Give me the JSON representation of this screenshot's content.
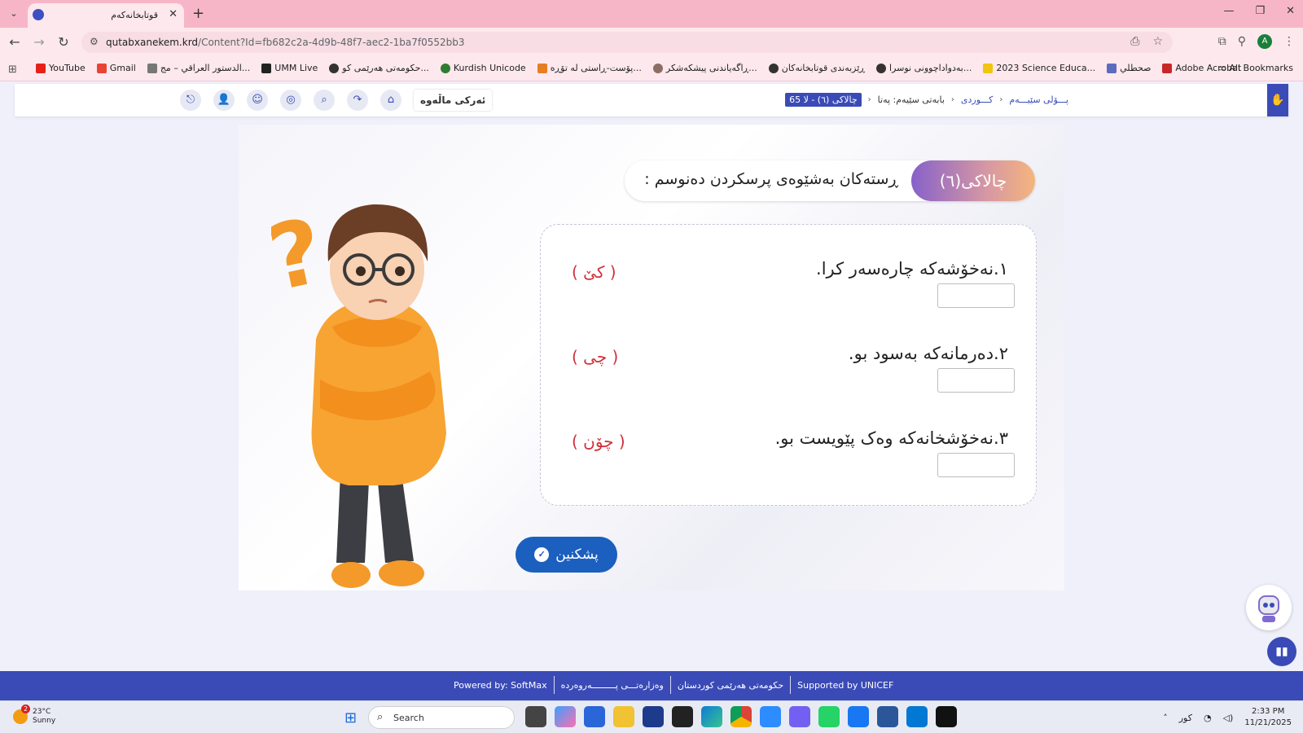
{
  "browser": {
    "tab_title": "قوتابخانەکەم",
    "url_host": "qutabxanekem.krd",
    "url_path": "/Content?Id=fb682c2a-4d9b-48f7-aec2-1ba7f0552bb3",
    "bookmarks": [
      "YouTube",
      "Gmail",
      "الدستور العراقي – مج...",
      "UMM Live",
      "حکومەتی هەرێمی کو...",
      "Kurdish Unicode",
      "پۆست-ڕاستی لە تۆڕە...",
      "ڕاگەیاندنی پیشکەشکر...",
      "ڕێزبەندی قوتابخانەکان",
      "بەدواداچوونی نوسرا...",
      "2023 Science Educa...",
      "صحطلي",
      "Adobe Acrobat"
    ],
    "all_bookmarks": "All Bookmarks",
    "profile_initial": "A"
  },
  "header": {
    "breadcrumb": [
      "پـــۆلی سێیـــەم",
      "کـــوردی",
      "بابەتی سێیەم: پەتا",
      "چالاکی (٦) - لا 65"
    ],
    "homework_label": "ئەرکی ماڵەوە"
  },
  "activity": {
    "badge": "چالاکی(٦)",
    "instruction": "ڕستەکان بەشێوەی پرسکردن دەنوسم :",
    "questions": [
      {
        "text": "١.نەخۆشەکە چارەسەر کرا.",
        "hint": "( کێ )"
      },
      {
        "text": "٢.دەرمانەکە بەسود بو.",
        "hint": "( چی )"
      },
      {
        "text": "٣.نەخۆشخانەکە وەک پێویست بو.",
        "hint": "( چۆن )"
      }
    ],
    "check_label": "پشکنین"
  },
  "footer": {
    "items": [
      "Powered by: SoftMax",
      "وەزارەتـــی پـــــــــەروەردە",
      "حکومەتی هەرێمی کوردستان",
      "Supported by UNICEF"
    ]
  },
  "taskbar": {
    "weather_temp": "23°C",
    "weather_desc": "Sunny",
    "weather_badge": "2",
    "search_placeholder": "Search",
    "language": "کور",
    "time": "2:33 PM",
    "date": "11/21/2025"
  },
  "colors": {
    "brand": "#3a4bb7",
    "hint_red": "#d0303a",
    "check_button": "#1b5fbf",
    "tab_bar": "#f7b6c7"
  }
}
